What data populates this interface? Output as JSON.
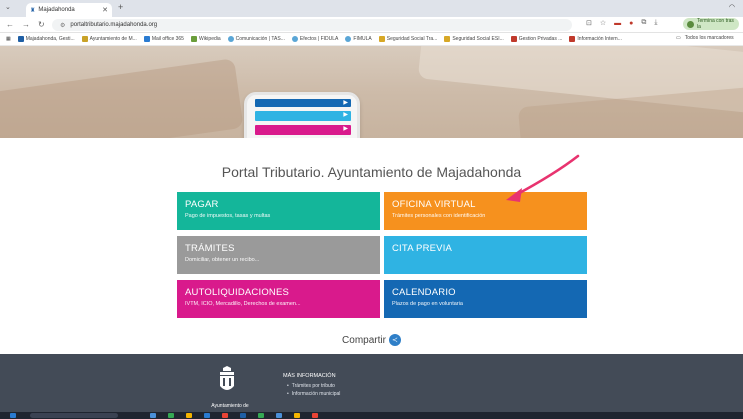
{
  "browser": {
    "tab_title": "Majadahonda",
    "url": "portaltributario.majadahonda.org",
    "profile_label": "Termina con tras la",
    "bookmarks": [
      {
        "label": "Majadahonda, Gesti...",
        "color": "#1f5fa5"
      },
      {
        "label": "Ayuntamiento de M...",
        "color": "#c9a227"
      },
      {
        "label": "Mail office 365",
        "color": "#2a7bd1"
      },
      {
        "label": "Wikipedia",
        "color": "#6a9d3a"
      },
      {
        "label": "Comunicación | TAS...",
        "color": "#5aa6d6"
      },
      {
        "label": "Efectos | FIDULA",
        "color": "#5aa6d6"
      },
      {
        "label": "FIMULA",
        "color": "#5aa6d6"
      },
      {
        "label": "Seguridad Social Tra...",
        "color": "#d7a826"
      },
      {
        "label": "Seguridad Social ESI...",
        "color": "#d7a826"
      },
      {
        "label": "Gestion Privadas ...",
        "color": "#c0392b"
      },
      {
        "label": "Información Intern...",
        "color": "#c0392b"
      }
    ],
    "bookmarks_right": "Todos los marcadores"
  },
  "page": {
    "title": "Portal Tributario. Ayuntamiento de Majadahonda",
    "share_label": "Compartir",
    "tiles": [
      {
        "title": "PAGAR",
        "subtitle": "Pago de impuestos, tasas y multas",
        "color": "#14b69a"
      },
      {
        "title": "OFICINA VIRTUAL",
        "subtitle": "Trámites personales con identificación",
        "color": "#f6911e"
      },
      {
        "title": "TRÁMITES",
        "subtitle": "Domiciliar, obtener un recibo...",
        "color": "#9a9a9a"
      },
      {
        "title": "CITA PREVIA",
        "subtitle": "",
        "color": "#2fb3e3"
      },
      {
        "title": "AUTOLIQUIDACIONES",
        "subtitle": "IVTM, ICIO, Mercadillo, Derechos de examen...",
        "color": "#d91a8c"
      },
      {
        "title": "CALENDARIO",
        "subtitle": "Plazos de pago en voluntaria",
        "color": "#1468b3"
      }
    ],
    "arrow_color": "#e8336f"
  },
  "footer": {
    "crest_text": "Ayuntamiento de",
    "more_info": "MÁS INFORMACIÓN",
    "links": [
      "Trámites por tributo",
      "Información municipal"
    ]
  }
}
